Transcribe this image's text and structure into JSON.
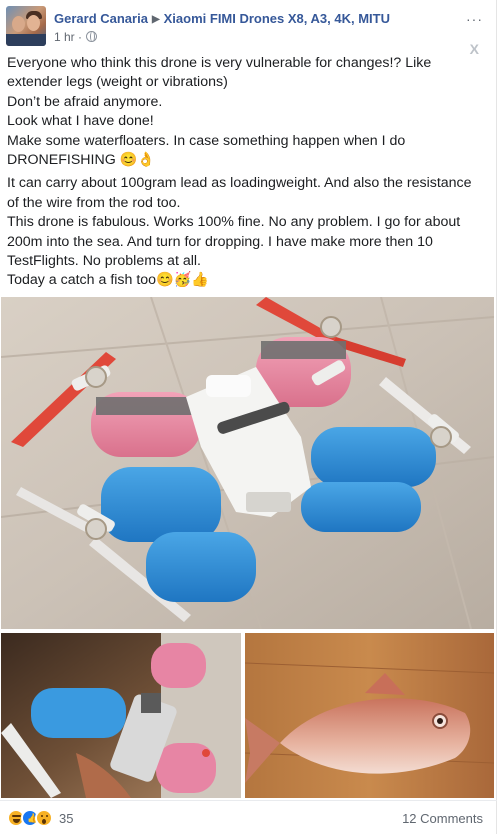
{
  "post": {
    "author": "Gerard Canaria",
    "group": "Xiaomi FIMI Drones X8, A3, 4K, MITU",
    "time": "1 hr",
    "more_label": "···",
    "close_label": "X",
    "paragraphs": [
      [
        "Everyone who think this drone is very vulnerable for changes!? Like extender legs (weight or vibrations)",
        "Don’t be afraid anymore.",
        "Look what I have done!",
        "Make some waterfloaters. In case something happen when I do DRONEFISHING 😊👌"
      ],
      [
        "It can carry about 100gram lead as loadingweight. And also the resistance of the wire from the rod too.",
        "This drone is fabulous. Works 100% fine. No any problem. I go for about 200m into the sea. And turn for dropping. I have make more then 10 TestFlights. No problems at all.",
        "Today a catch a fish too😊🥳👍"
      ]
    ]
  },
  "photos": {
    "main": "drone-with-pool-noodle-floats",
    "bottom_left": "drone-float-closeup",
    "bottom_right": "caught-fish"
  },
  "footer": {
    "reaction_icons": [
      "haha-icon",
      "like-icon",
      "wow-icon"
    ],
    "reaction_count": "35",
    "comments": "12 Comments"
  },
  "colors": {
    "link_blue": "#365899",
    "meta_gray": "#606770",
    "like_blue": "#1877f2",
    "reaction_yellow": "#f7b125"
  }
}
